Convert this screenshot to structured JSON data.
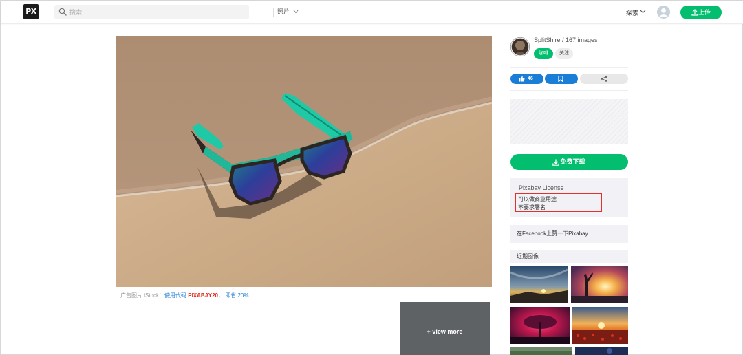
{
  "header": {
    "logo_text": "PX",
    "search_placeholder": "搜索",
    "search_type": "照片",
    "explore_label": "探索",
    "upload_label": "上传",
    "accent_color": "#02be6e"
  },
  "main": {
    "photo_subject": "sunglasses on sand at the shoreline",
    "ad_prefix": "广告图片 iStock：",
    "ad_link_text": "使用代码",
    "ad_code": "PIXABAY20",
    "ad_suffix": "，",
    "ad_discount_text": "即省 20%",
    "view_more_label": "+ view more"
  },
  "sidebar": {
    "author_line": "SplitShire / 167 images",
    "sponsor_label": "咖啡",
    "follow_label": "关注",
    "like_count": "46",
    "download_label": "免费下载",
    "license_title": "Pixabay License",
    "license_line1": "可以做商业用途",
    "license_line2": "不要求署名",
    "facebook_text": "在Facebook上赞一下Pixabay",
    "recent_label": "近期图像",
    "highlight_color": "#e03030",
    "button_blue": "#1a7ed6"
  },
  "icons": [
    "search-icon",
    "chevron-down-icon",
    "user-avatar-icon",
    "upload-icon",
    "thumbs-up-icon",
    "bookmark-icon",
    "share-icon",
    "download-icon"
  ]
}
